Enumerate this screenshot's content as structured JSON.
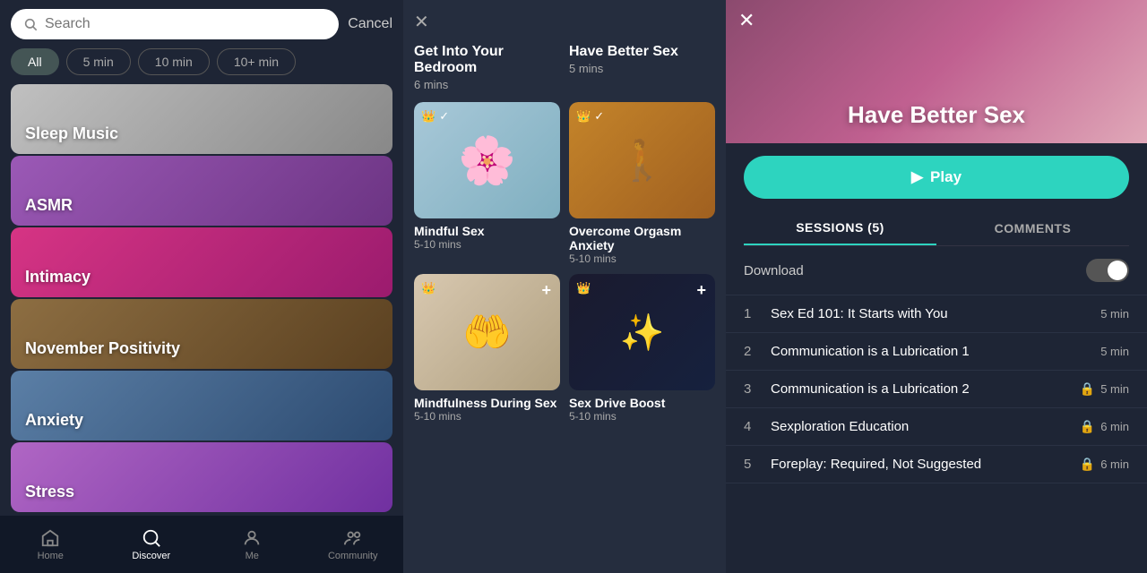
{
  "search": {
    "placeholder": "Search",
    "cancel_label": "Cancel"
  },
  "filters": [
    {
      "label": "All",
      "active": true
    },
    {
      "label": "5 min",
      "active": false
    },
    {
      "label": "10 min",
      "active": false
    },
    {
      "label": "10+ min",
      "active": false
    }
  ],
  "categories": [
    {
      "id": "sleep",
      "label": "Sleep Music",
      "class": "cat-sleep"
    },
    {
      "id": "asmr",
      "label": "ASMR",
      "class": "cat-asmr"
    },
    {
      "id": "intimacy",
      "label": "Intimacy",
      "class": "cat-intimacy"
    },
    {
      "id": "november",
      "label": "November Positivity",
      "class": "cat-november"
    },
    {
      "id": "anxiety",
      "label": "Anxiety",
      "class": "cat-anxiety"
    },
    {
      "id": "stress",
      "label": "Stress",
      "class": "cat-stress"
    }
  ],
  "nav": {
    "items": [
      {
        "id": "home",
        "label": "Home",
        "icon": "⌂",
        "active": false
      },
      {
        "id": "discover",
        "label": "Discover",
        "icon": "⊙",
        "active": true
      },
      {
        "id": "me",
        "label": "Me",
        "icon": "◯",
        "active": false
      },
      {
        "id": "community",
        "label": "Community",
        "icon": "⊕",
        "active": false
      }
    ]
  },
  "middle": {
    "header_sessions": [
      {
        "title": "Get Into Your Bedroom",
        "duration": "6 mins"
      },
      {
        "title": "Have Better Sex",
        "duration": "5 mins"
      }
    ],
    "sessions": [
      {
        "title": "Mindful Sex",
        "duration": "5-10 mins",
        "thumb_class": "thumb-mindful-sex",
        "has_crown": true,
        "has_check": true,
        "has_plus": false,
        "thumb_art": "🌸"
      },
      {
        "title": "Overcome Orgasm Anxiety",
        "duration": "5-10 mins",
        "thumb_class": "thumb-orgasm",
        "has_crown": true,
        "has_check": true,
        "has_plus": false,
        "thumb_art": "🚶"
      },
      {
        "title": "Mindfulness During Sex",
        "duration": "5-10 mins",
        "thumb_class": "thumb-mindfulness",
        "has_crown": true,
        "has_check": false,
        "has_plus": true,
        "thumb_art": "🤲"
      },
      {
        "title": "Sex Drive Boost",
        "duration": "5-10 mins",
        "thumb_class": "thumb-sex-drive",
        "has_crown": true,
        "has_check": false,
        "has_plus": true,
        "thumb_art": "✨"
      }
    ]
  },
  "right": {
    "title": "Have Better Sex",
    "play_label": "Play",
    "tabs": [
      {
        "label": "SESSIONS (5)",
        "active": true
      },
      {
        "label": "COMMENTS",
        "active": false
      }
    ],
    "download_label": "Download",
    "sessions": [
      {
        "num": 1,
        "title": "Sex Ed 101: It Starts with You",
        "duration": "5 min",
        "locked": false
      },
      {
        "num": 2,
        "title": "Communication is a Lubrication 1",
        "duration": "5 min",
        "locked": false
      },
      {
        "num": 3,
        "title": "Communication is a Lubrication 2",
        "duration": "5 min",
        "locked": true
      },
      {
        "num": 4,
        "title": "Sexploration Education",
        "duration": "6 min",
        "locked": true
      },
      {
        "num": 5,
        "title": "Foreplay: Required, Not Suggested",
        "duration": "6 min",
        "locked": true
      }
    ]
  }
}
